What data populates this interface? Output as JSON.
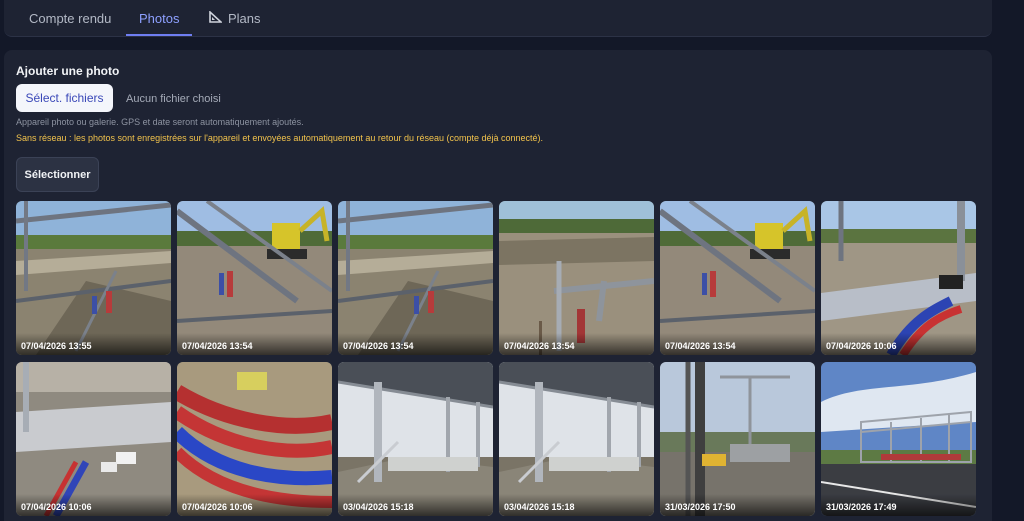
{
  "tabs": [
    {
      "label": "Compte rendu",
      "icon": "",
      "active": false
    },
    {
      "label": "Photos",
      "icon": "",
      "active": true
    },
    {
      "label": "Plans",
      "icon": "triangle-ruler-icon",
      "active": false
    }
  ],
  "upload": {
    "title": "Ajouter une photo",
    "file_button": "Sélect. fichiers",
    "file_status": "Aucun fichier choisi",
    "hint": "Appareil photo ou galerie. GPS et date seront automatiquement ajoutés.",
    "offline_warning": "Sans réseau : les photos sont enregistrées sur l'appareil et envoyées automatiquement au retour du réseau (compte déjà connecté)."
  },
  "select_button": "Sélectionner",
  "photos": [
    {
      "date": "07/04/2026 13:55",
      "scene": "trench"
    },
    {
      "date": "07/04/2026 13:54",
      "scene": "excavator"
    },
    {
      "date": "07/04/2026 13:54",
      "scene": "trench"
    },
    {
      "date": "07/04/2026 13:54",
      "scene": "pipes"
    },
    {
      "date": "07/04/2026 13:54",
      "scene": "excavator"
    },
    {
      "date": "07/04/2026 10:06",
      "scene": "beam"
    },
    {
      "date": "07/04/2026 10:06",
      "scene": "gravel"
    },
    {
      "date": "07/04/2026 10:06",
      "scene": "cables"
    },
    {
      "date": "03/04/2026 15:18",
      "scene": "roof"
    },
    {
      "date": "03/04/2026 15:18",
      "scene": "roof"
    },
    {
      "date": "31/03/2026 17:50",
      "scene": "drill"
    },
    {
      "date": "31/03/2026 17:49",
      "scene": "road"
    }
  ],
  "colors": {
    "accent": "#6f7ef2",
    "warning": "#f2c34c",
    "panel": "#1e2333",
    "background": "#131828"
  }
}
